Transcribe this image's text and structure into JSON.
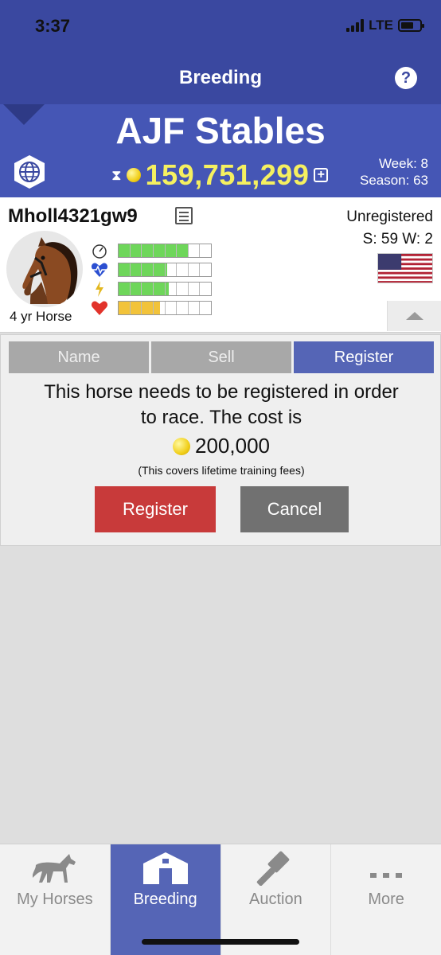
{
  "status": {
    "time": "3:37",
    "network": "LTE"
  },
  "nav": {
    "title": "Breeding",
    "help_glyph": "?"
  },
  "stable": {
    "name": "AJF Stables",
    "funds": "159,751,299",
    "week": "Week: 8",
    "season": "Season: 63",
    "icons": [
      "globe-icon",
      "hourglass-icon",
      "coin-icon",
      "plus-icon"
    ]
  },
  "horse": {
    "name": "Mholl4321gw9",
    "age_label": "4 yr Horse",
    "registration": "Unregistered",
    "record": "S: 59  W: 2",
    "flag": "us-flag",
    "stats": [
      {
        "name": "speed",
        "icon": "speedometer-icon",
        "level": 0.75,
        "color": "#6ed65a"
      },
      {
        "name": "stamina",
        "icon": "heartbeat-icon",
        "level": 0.53,
        "color": "#6ed65a"
      },
      {
        "name": "energy",
        "icon": "lightning-icon",
        "level": 0.54,
        "color": "#6ed65a"
      },
      {
        "name": "health",
        "icon": "heart-icon",
        "level": 0.45,
        "color": "#f2c33a"
      }
    ]
  },
  "panel": {
    "tabs": [
      {
        "label": "Name",
        "active": false
      },
      {
        "label": "Sell",
        "active": false
      },
      {
        "label": "Register",
        "active": true
      }
    ],
    "message_line1": "This horse needs to be registered in order",
    "message_line2": "to race. The cost is",
    "cost": "200,000",
    "note": "(This covers lifetime training fees)",
    "register_label": "Register",
    "cancel_label": "Cancel"
  },
  "tabbar": [
    {
      "label": "My Horses",
      "icon": "horse-icon",
      "active": false
    },
    {
      "label": "Breeding",
      "icon": "barn-icon",
      "active": true
    },
    {
      "label": "Auction",
      "icon": "gavel-icon",
      "active": false
    },
    {
      "label": "More",
      "icon": "more-dots-icon",
      "active": false
    }
  ],
  "colors": {
    "nav_bg": "#3a48a0",
    "accent": "#5565b6",
    "funds": "#f5f060",
    "danger": "#c83a3a"
  }
}
